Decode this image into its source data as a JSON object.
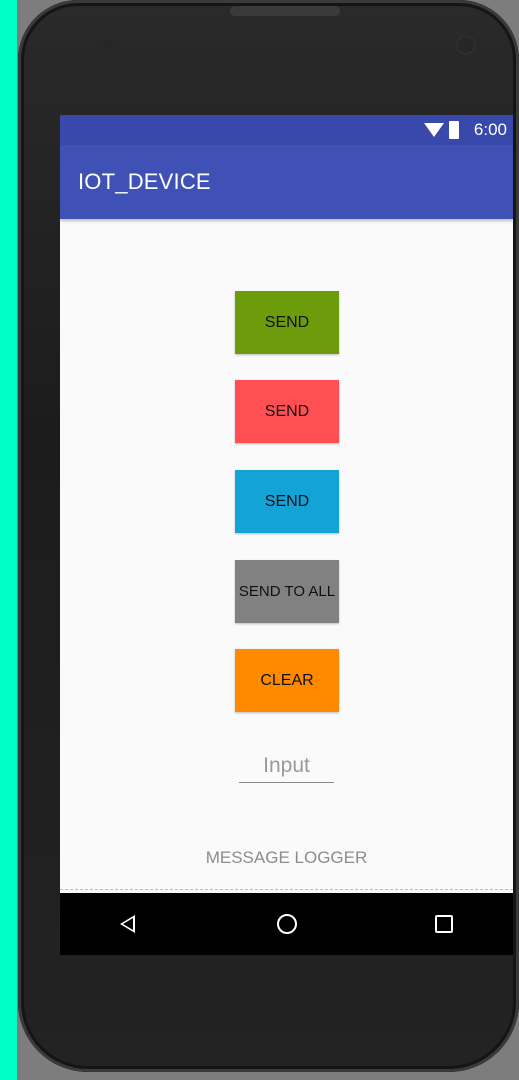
{
  "status_bar": {
    "time": "6:00"
  },
  "app_bar": {
    "title": "IOT_DEVICE"
  },
  "buttons": {
    "send_1": {
      "label": "SEND",
      "color": "#6c9b0b"
    },
    "send_2": {
      "label": "SEND",
      "color": "#ff4f52"
    },
    "send_3": {
      "label": "SEND",
      "color": "#13a3d6"
    },
    "send_to_all": {
      "label": "SEND TO ALL",
      "color": "#818181"
    },
    "clear": {
      "label": "CLEAR",
      "color": "#ff8a00"
    }
  },
  "input": {
    "placeholder": "Input",
    "value": ""
  },
  "logger": {
    "label": "MESSAGE LOGGER"
  },
  "nav_bar": {
    "back_icon": "back-triangle-icon",
    "home_icon": "home-circle-icon",
    "recents_icon": "recents-square-icon"
  },
  "colors": {
    "status_bar": "#3949ab",
    "app_bar": "#3f51b5",
    "accent_strip": "#00ffc4"
  }
}
